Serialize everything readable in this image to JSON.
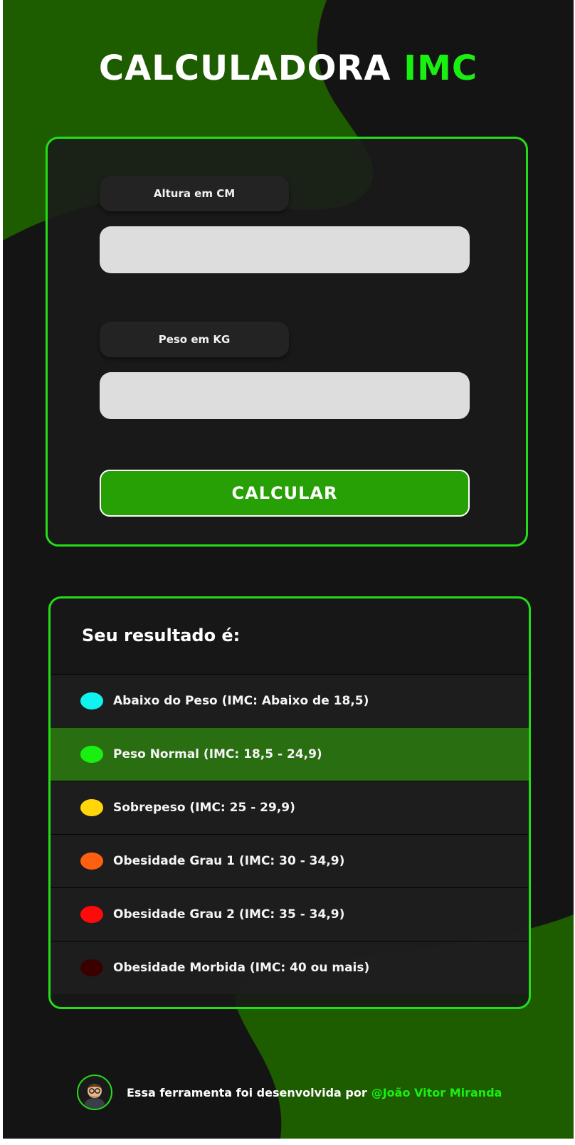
{
  "header": {
    "title_main": "CALCULADORA",
    "title_accent": "IMC"
  },
  "form": {
    "height_label": "Altura em CM",
    "height_value": "",
    "weight_label": "Peso em KG",
    "weight_value": "",
    "submit_label": "CALCULAR"
  },
  "result": {
    "title": "Seu resultado é:",
    "categories": [
      {
        "label": "Abaixo do Peso (IMC: Abaixo de 18,5)",
        "color": "#0ef5f0",
        "highlighted": false
      },
      {
        "label": "Peso Normal (IMC: 18,5 - 24,9)",
        "color": "#1aef12",
        "highlighted": true
      },
      {
        "label": "Sobrepeso (IMC: 25 - 29,9)",
        "color": "#ffd60a",
        "highlighted": false
      },
      {
        "label": "Obesidade Grau 1 (IMC: 30 - 34,9)",
        "color": "#ff6010",
        "highlighted": false
      },
      {
        "label": "Obesidade Grau 2 (IMC: 35 - 34,9)",
        "color": "#ff0a0a",
        "highlighted": false
      },
      {
        "label": "Obesidade Morbida (IMC: 40 ou mais)",
        "color": "#3a0000",
        "highlighted": false
      }
    ]
  },
  "footer": {
    "text": "Essa ferramenta foi desenvolvida por",
    "author_link": "@João Vitor Miranda"
  },
  "theme": {
    "accent": "#1aef12",
    "background": "#141414",
    "blob": "#1e5c00"
  }
}
